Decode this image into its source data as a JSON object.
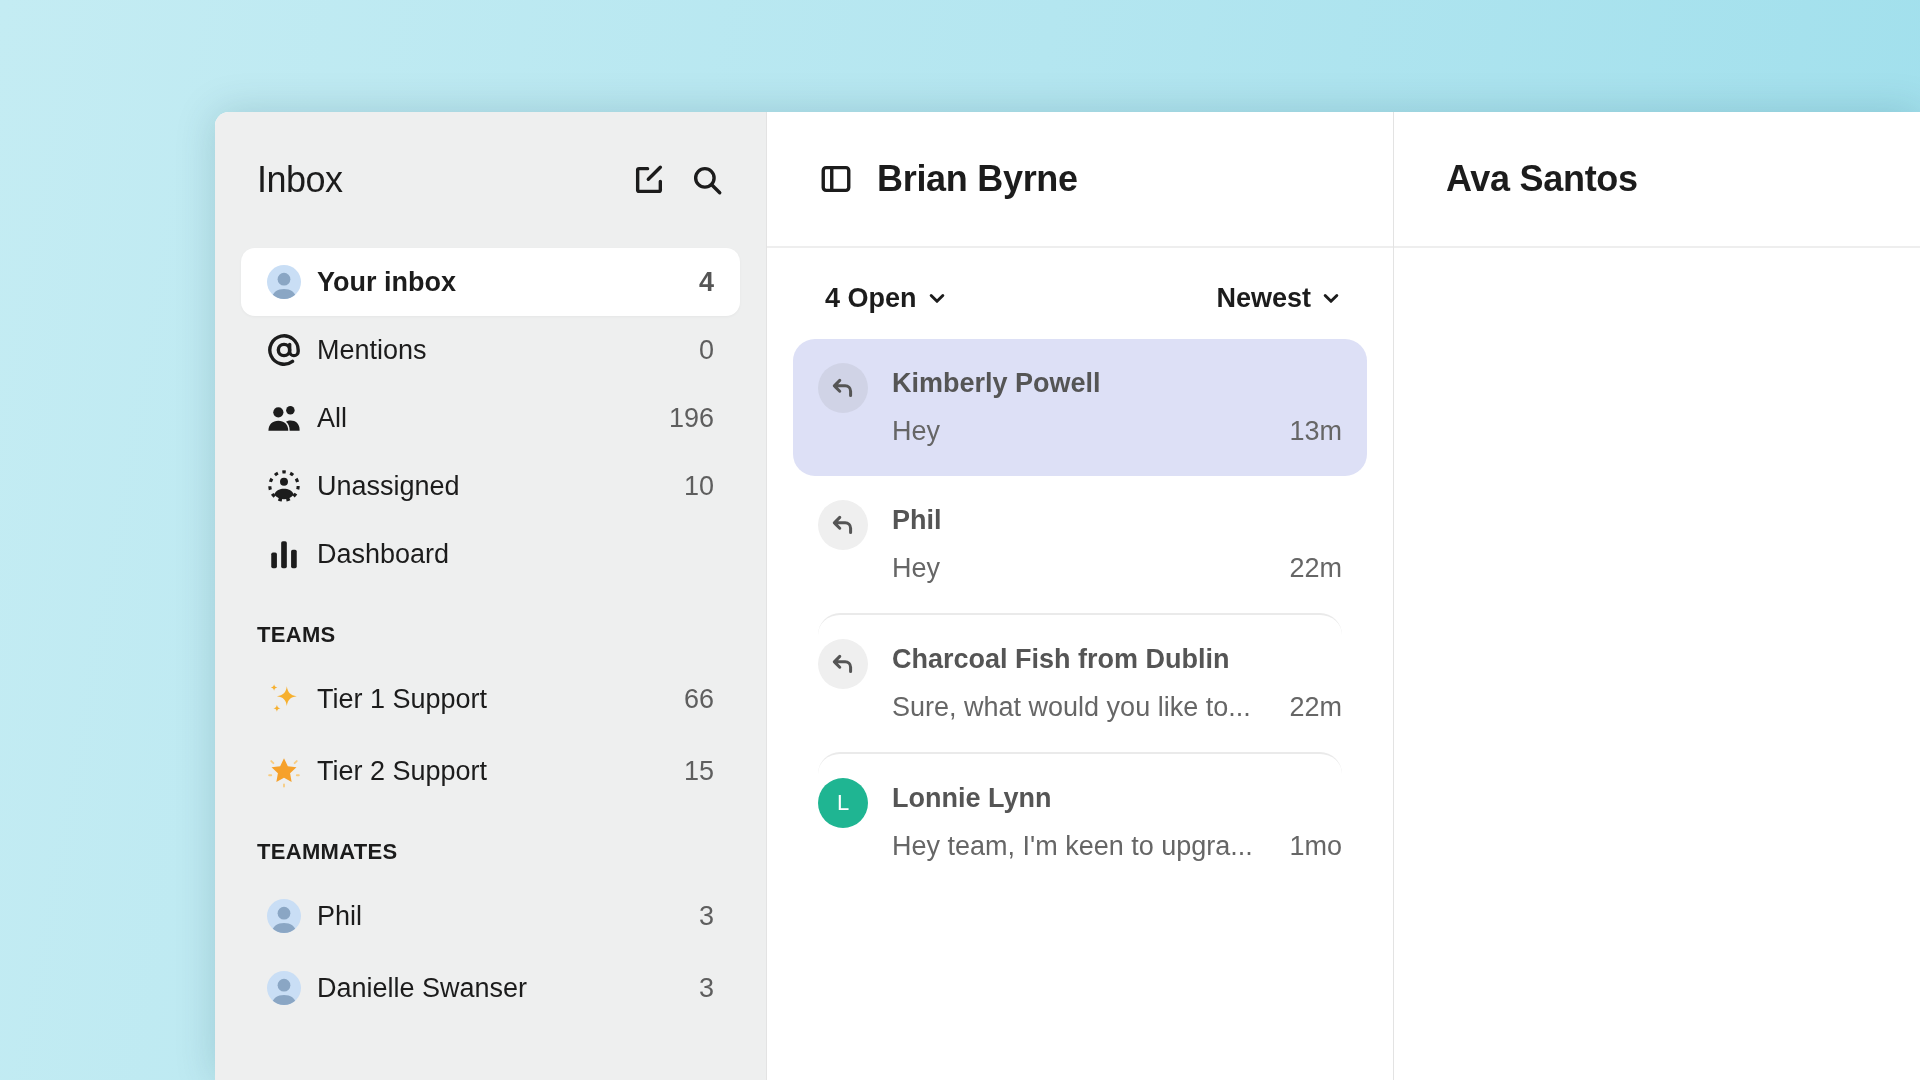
{
  "sidebar": {
    "title": "Inbox",
    "items": [
      {
        "label": "Your inbox",
        "count": "4",
        "kind": "avatar",
        "selected": true
      },
      {
        "label": "Mentions",
        "count": "0",
        "kind": "at",
        "selected": false
      },
      {
        "label": "All",
        "count": "196",
        "kind": "people",
        "selected": false
      },
      {
        "label": "Unassigned",
        "count": "10",
        "kind": "unassigned",
        "selected": false
      },
      {
        "label": "Dashboard",
        "kind": "chart",
        "selected": false
      }
    ],
    "sections": [
      {
        "heading": "TEAMS",
        "items": [
          {
            "label": "Tier 1 Support",
            "count": "66",
            "kind": "sparkles"
          },
          {
            "label": "Tier 2 Support",
            "count": "15",
            "kind": "star"
          }
        ]
      },
      {
        "heading": "TEAMMATES",
        "items": [
          {
            "label": "Phil",
            "count": "3",
            "kind": "avatar"
          },
          {
            "label": "Danielle Swanser",
            "count": "3",
            "kind": "avatar"
          }
        ]
      }
    ]
  },
  "conversations_panel": {
    "title": "Brian Byrne",
    "filter": "4 Open",
    "sort": "Newest",
    "conversations": [
      {
        "name": "Kimberly Powell",
        "preview": "Hey",
        "time": "13m",
        "kind": "reply",
        "selected": true
      },
      {
        "name": "Phil",
        "preview": "Hey",
        "time": "22m",
        "kind": "reply",
        "selected": false
      },
      {
        "name": "Charcoal Fish from Dublin",
        "preview": "Sure, what would you like to...",
        "time": "22m",
        "kind": "reply",
        "selected": false
      },
      {
        "name": "Lonnie Lynn",
        "preview": "Hey team, I'm keen to upgra...",
        "time": "1mo",
        "kind": "initial",
        "initial": "L",
        "selected": false
      }
    ]
  },
  "detail_panel": {
    "title": "Ava Santos"
  }
}
